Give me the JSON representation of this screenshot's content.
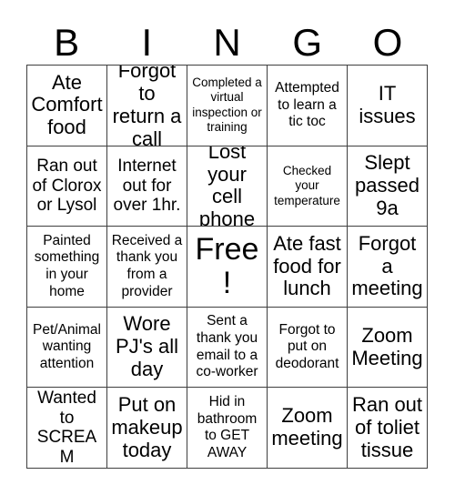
{
  "header": {
    "letters": [
      "B",
      "I",
      "N",
      "G",
      "O"
    ]
  },
  "grid": {
    "rows": [
      [
        {
          "text": "Ate Comfort food",
          "size": "lg"
        },
        {
          "text": "Forgot to return a call",
          "size": "lg"
        },
        {
          "text": "Completed a virtual inspection or training",
          "size": "xs"
        },
        {
          "text": "Attempted to learn a tic toc",
          "size": "sm"
        },
        {
          "text": "IT issues",
          "size": "lg"
        }
      ],
      [
        {
          "text": "Ran out of Clorox or Lysol",
          "size": "md"
        },
        {
          "text": "Internet out for over 1hr.",
          "size": "md"
        },
        {
          "text": "Lost your cell phone",
          "size": "lg"
        },
        {
          "text": "Checked your temperature",
          "size": "xs"
        },
        {
          "text": "Slept passed 9a",
          "size": "lg"
        }
      ],
      [
        {
          "text": "Painted something in your home",
          "size": "sm"
        },
        {
          "text": "Received a thank you from a provider",
          "size": "sm"
        },
        {
          "text": "Free!",
          "size": "xl"
        },
        {
          "text": "Ate fast food for lunch",
          "size": "lg"
        },
        {
          "text": "Forgot a meeting",
          "size": "lg"
        }
      ],
      [
        {
          "text": "Pet/Animal wanting attention",
          "size": "sm"
        },
        {
          "text": "Wore PJ's all day",
          "size": "lg"
        },
        {
          "text": "Sent a thank you email to a co-worker",
          "size": "sm"
        },
        {
          "text": "Forgot to put on deodorant",
          "size": "sm"
        },
        {
          "text": "Zoom Meeting",
          "size": "lg"
        }
      ],
      [
        {
          "text": "Wanted to SCREAM",
          "size": "md"
        },
        {
          "text": "Put on makeup today",
          "size": "lg"
        },
        {
          "text": "Hid in bathroom to GET AWAY",
          "size": "sm"
        },
        {
          "text": "Zoom meeting",
          "size": "lg"
        },
        {
          "text": "Ran out of toliet tissue",
          "size": "lg"
        }
      ]
    ]
  },
  "colors": {
    "background": "#ffffff",
    "text": "#000000",
    "border": "#3f3f3f"
  }
}
